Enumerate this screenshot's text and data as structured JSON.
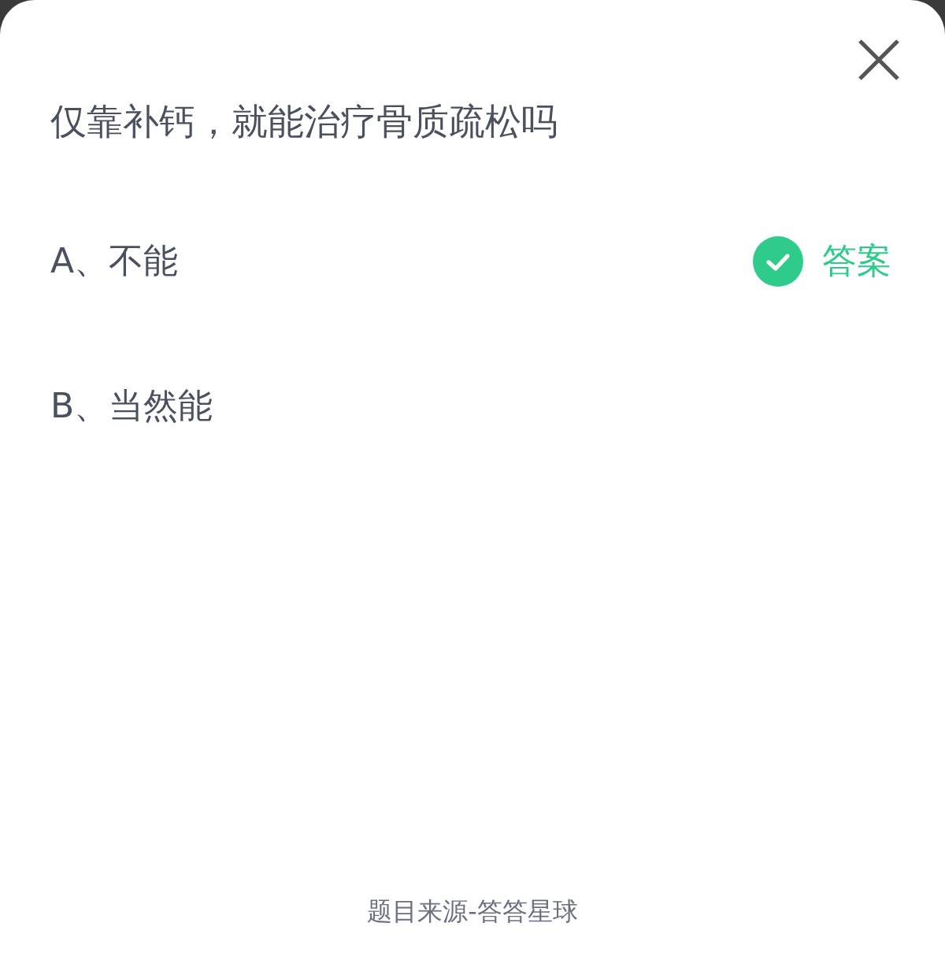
{
  "question": "仅靠补钙，就能治疗骨质疏松吗",
  "answer_label": "答案",
  "options": [
    {
      "text": "A、不能",
      "correct": true
    },
    {
      "text": "B、当然能",
      "correct": false
    }
  ],
  "footer": "题目来源-答答星球"
}
